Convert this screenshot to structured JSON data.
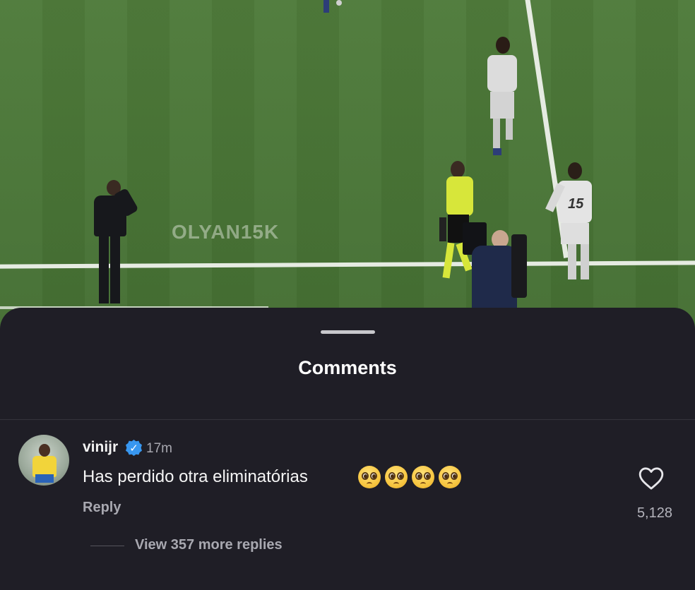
{
  "video": {
    "watermark": "OLYAN15K",
    "player_number": "15"
  },
  "comments_sheet": {
    "title": "Comments",
    "comment": {
      "username": "vinijr",
      "verified_icon": "verified-badge-icon",
      "time": "17m",
      "text": "Has perdido otra eliminatórias",
      "emojis": [
        "pleading-face",
        "pleading-face",
        "pleading-face",
        "pleading-face"
      ],
      "reply_label": "Reply",
      "like_count": "5,128",
      "like_icon": "heart-outline-icon"
    },
    "view_replies_label": "View 357 more replies"
  },
  "colors": {
    "sheet_background": "#1f1e26",
    "verified_blue": "#3897f0",
    "muted_text": "#a8a8b0",
    "pitch_green": "#4a7637"
  }
}
